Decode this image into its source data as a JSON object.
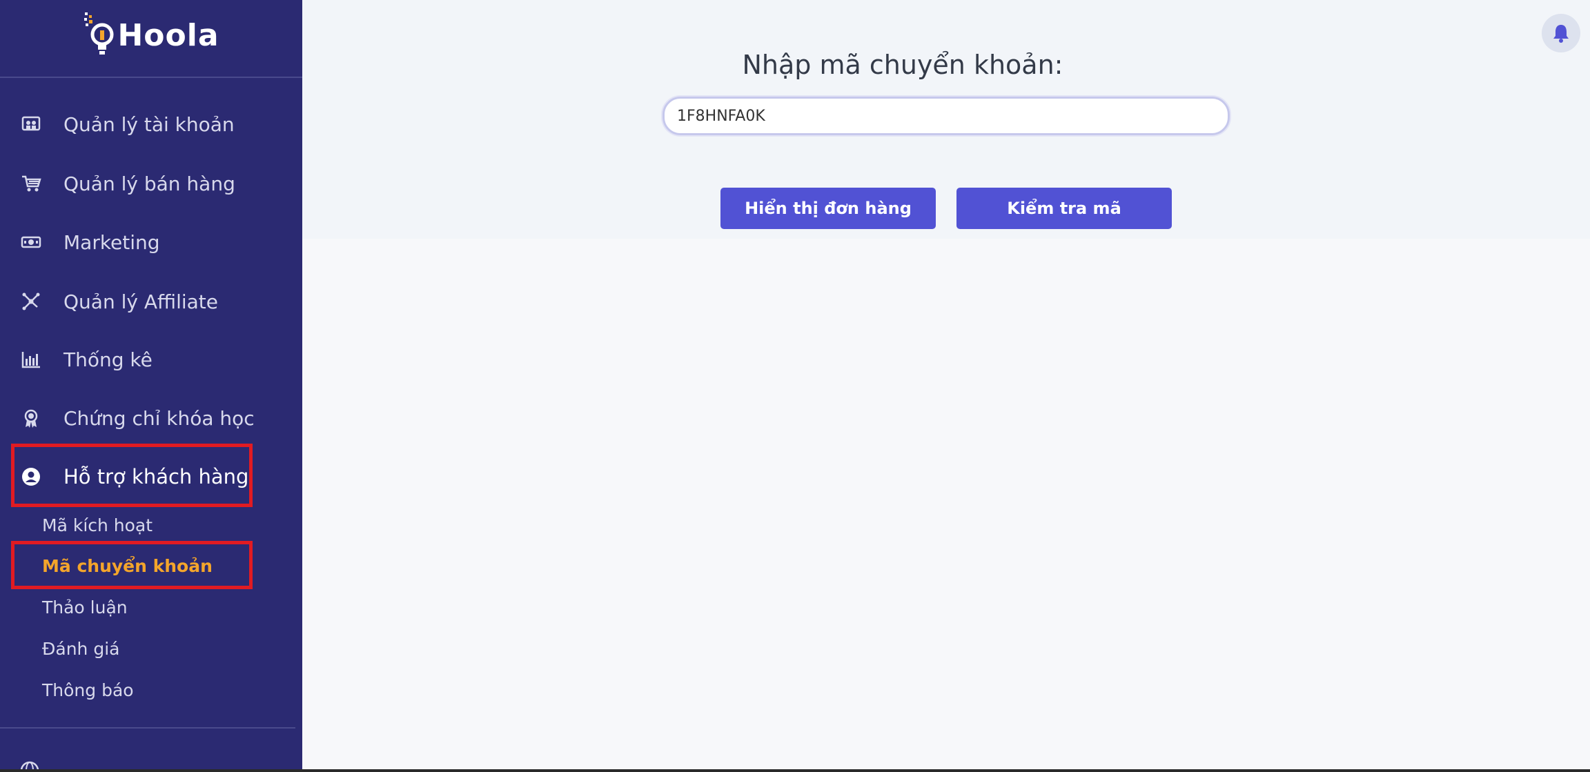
{
  "brand": {
    "name": "Hoola"
  },
  "sidebar": {
    "items": [
      {
        "label": "Quản lý tài khoản",
        "icon": "user-group-icon"
      },
      {
        "label": "Quản lý bán hàng",
        "icon": "cart-icon"
      },
      {
        "label": "Marketing",
        "icon": "money-icon"
      },
      {
        "label": "Quản lý Affiliate",
        "icon": "network-icon"
      },
      {
        "label": "Thống kê",
        "icon": "bar-chart-icon"
      },
      {
        "label": "Chứng chỉ khóa học",
        "icon": "award-icon"
      },
      {
        "label": "Hỗ trợ khách hàng",
        "icon": "user-circle-icon"
      }
    ],
    "subitems": [
      {
        "label": "Mã kích hoạt"
      },
      {
        "label": "Mã chuyển khoản"
      },
      {
        "label": "Thảo luận"
      },
      {
        "label": "Đánh giá"
      },
      {
        "label": "Thông báo"
      }
    ],
    "active_item": "Hỗ trợ khách hàng",
    "current_subitem": "Mã chuyển khoản"
  },
  "main": {
    "form_title": "Nhập mã chuyển khoản:",
    "code_value": "1F8HNFA0K",
    "show_order_button": "Hiển thị đơn hàng",
    "check_code_button": "Kiểm tra mã"
  },
  "colors": {
    "sidebar_bg": "#2b2a72",
    "accent": "#5152d4",
    "current_subitem": "#f4a52b",
    "highlight": "#e11b22"
  }
}
